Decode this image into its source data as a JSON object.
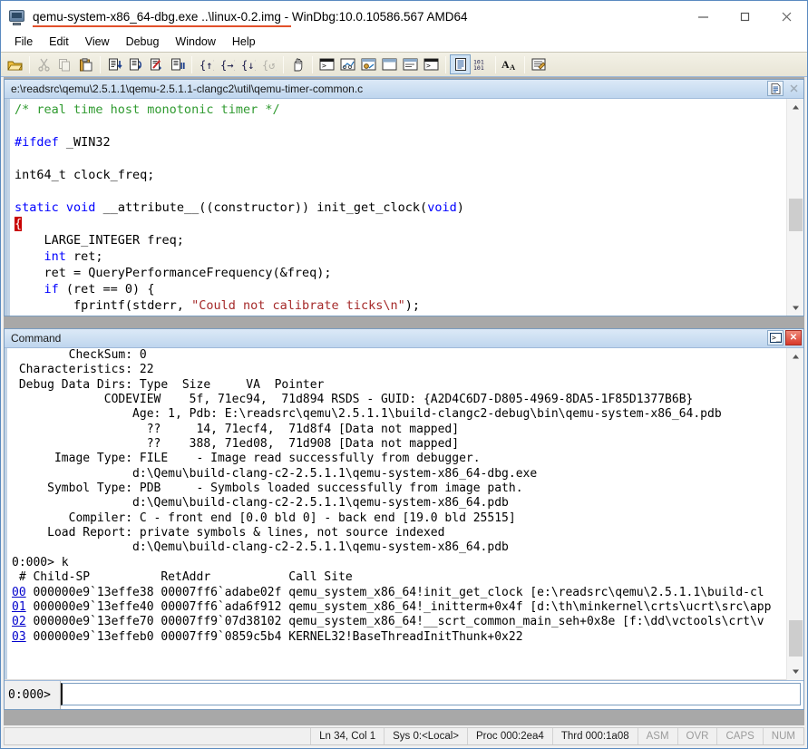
{
  "window": {
    "title": "qemu-system-x86_64-dbg.exe ..\\linux-0.2.img - WinDbg:10.0.10586.567 AMD64",
    "app_icon": "windbg-icon",
    "accent_underline_color": "#e2502a",
    "controls": {
      "minimize": "minimize-icon",
      "maximize": "maximize-icon",
      "close": "close-icon"
    }
  },
  "menubar": {
    "items": [
      {
        "label": "File"
      },
      {
        "label": "Edit"
      },
      {
        "label": "View"
      },
      {
        "label": "Debug"
      },
      {
        "label": "Window"
      },
      {
        "label": "Help"
      }
    ]
  },
  "toolbar": {
    "groups": [
      {
        "buttons": [
          {
            "name": "open-folder-icon",
            "enabled": true
          }
        ]
      },
      {
        "buttons": [
          {
            "name": "cut-icon",
            "enabled": false
          },
          {
            "name": "copy-icon",
            "enabled": false
          },
          {
            "name": "paste-icon",
            "enabled": true
          }
        ]
      },
      {
        "buttons": [
          {
            "name": "step-into-source-icon",
            "enabled": true
          },
          {
            "name": "step-over-source-icon",
            "enabled": true
          },
          {
            "name": "run-to-cursor-icon",
            "enabled": true
          },
          {
            "name": "break-icon",
            "enabled": true
          }
        ]
      },
      {
        "buttons": [
          {
            "name": "step-into-icon",
            "enabled": true
          },
          {
            "name": "step-over-icon",
            "enabled": true
          },
          {
            "name": "step-out-icon",
            "enabled": true
          },
          {
            "name": "restart-icon",
            "enabled": false
          }
        ]
      },
      {
        "buttons": [
          {
            "name": "stop-debugging-hand-icon",
            "enabled": true
          }
        ]
      },
      {
        "buttons": [
          {
            "name": "command-window-icon",
            "enabled": true
          },
          {
            "name": "watch-window-icon",
            "enabled": true
          },
          {
            "name": "locals-window-icon",
            "enabled": true
          },
          {
            "name": "registers-window-icon",
            "enabled": true
          },
          {
            "name": "memory-window-icon",
            "enabled": true
          },
          {
            "name": "callstack-window-icon",
            "enabled": true
          },
          {
            "name": "disassembly-window-icon",
            "enabled": true
          },
          {
            "name": "scratch-pad-icon",
            "enabled": true
          },
          {
            "name": "processes-threads-icon",
            "enabled": true
          },
          {
            "name": "command-browser-icon",
            "enabled": true
          }
        ]
      },
      {
        "buttons": [
          {
            "name": "source-window-icon",
            "enabled": true,
            "selected": true
          },
          {
            "name": "numbers-base-icon",
            "enabled": true
          }
        ]
      },
      {
        "buttons": [
          {
            "name": "font-icon",
            "enabled": true
          }
        ]
      },
      {
        "buttons": [
          {
            "name": "notes-icon",
            "enabled": true
          }
        ]
      }
    ]
  },
  "source_window": {
    "title": "e:\\readsrc\\qemu\\2.5.1.1\\qemu-2.5.1.1-clangc2\\util\\qemu-timer-common.c",
    "buttons": {
      "restore": "restore-document-icon",
      "close": "close-icon"
    },
    "lines": [
      {
        "segments": [
          {
            "t": "/* real time host monotonic timer */",
            "c": "cmt"
          }
        ]
      },
      {
        "segments": [
          {
            "t": "",
            "c": ""
          }
        ]
      },
      {
        "segments": [
          {
            "t": "#ifdef",
            "c": "pp"
          },
          {
            "t": " _WIN32",
            "c": ""
          }
        ]
      },
      {
        "segments": [
          {
            "t": "",
            "c": ""
          }
        ]
      },
      {
        "segments": [
          {
            "t": "int64_t clock_freq;",
            "c": ""
          }
        ]
      },
      {
        "segments": [
          {
            "t": "",
            "c": ""
          }
        ]
      },
      {
        "segments": [
          {
            "t": "static",
            "c": "kw"
          },
          {
            "t": " ",
            "c": ""
          },
          {
            "t": "void",
            "c": "kw"
          },
          {
            "t": " __attribute__((constructor)) init_get_clock(",
            "c": ""
          },
          {
            "t": "void",
            "c": "kw"
          },
          {
            "t": ")",
            "c": ""
          }
        ]
      },
      {
        "segments": [
          {
            "t": "{",
            "c": "bphl"
          }
        ]
      },
      {
        "segments": [
          {
            "t": "    LARGE_INTEGER freq;",
            "c": ""
          }
        ]
      },
      {
        "segments": [
          {
            "t": "    ",
            "c": ""
          },
          {
            "t": "int",
            "c": "kw"
          },
          {
            "t": " ret;",
            "c": ""
          }
        ]
      },
      {
        "segments": [
          {
            "t": "    ret = QueryPerformanceFrequency(&freq);",
            "c": ""
          }
        ]
      },
      {
        "segments": [
          {
            "t": "    ",
            "c": ""
          },
          {
            "t": "if",
            "c": "kw"
          },
          {
            "t": " (ret == 0) {",
            "c": ""
          }
        ]
      },
      {
        "segments": [
          {
            "t": "        fprintf(stderr, ",
            "c": ""
          },
          {
            "t": "\"Could not calibrate ticks\\n\"",
            "c": "str"
          },
          {
            "t": ");",
            "c": ""
          }
        ]
      }
    ],
    "scrollbar": {
      "up": "scroll-up-icon",
      "down": "scroll-down-icon",
      "thumb_top_pct": 46,
      "thumb_height_pct": 18
    }
  },
  "command_window": {
    "title": "Command",
    "buttons": {
      "dock": "command-window-icon",
      "close": "close-icon"
    },
    "output_lines": [
      {
        "segments": [
          {
            "t": "        CheckSum: 0"
          }
        ]
      },
      {
        "segments": [
          {
            "t": " Characteristics: 22"
          }
        ]
      },
      {
        "segments": [
          {
            "t": " Debug Data Dirs: Type  Size     VA  Pointer"
          }
        ]
      },
      {
        "segments": [
          {
            "t": "             CODEVIEW    5f, 71ec94,  71d894 RSDS - GUID: {A2D4C6D7-D805-4969-8DA5-1F85D1377B6B}"
          }
        ]
      },
      {
        "segments": [
          {
            "t": "                 Age: 1, Pdb: E:\\readsrc\\qemu\\2.5.1.1\\build-clangc2-debug\\bin\\qemu-system-x86_64.pdb"
          }
        ]
      },
      {
        "segments": [
          {
            "t": "                   ??     14, 71ecf4,  71d8f4 [Data not mapped]"
          }
        ]
      },
      {
        "segments": [
          {
            "t": "                   ??    388, 71ed08,  71d908 [Data not mapped]"
          }
        ]
      },
      {
        "segments": [
          {
            "t": "      Image Type: FILE    - Image read successfully from debugger."
          }
        ]
      },
      {
        "segments": [
          {
            "t": "                 d:\\Qemu\\build-clang-c2-2.5.1.1\\qemu-system-x86_64-dbg.exe"
          }
        ]
      },
      {
        "segments": [
          {
            "t": "     Symbol Type: PDB     - Symbols loaded successfully from image path."
          }
        ]
      },
      {
        "segments": [
          {
            "t": "                 d:\\Qemu\\build-clang-c2-2.5.1.1\\qemu-system-x86_64.pdb"
          }
        ]
      },
      {
        "segments": [
          {
            "t": "        Compiler: C - front end [0.0 bld 0] - back end [19.0 bld 25515]"
          }
        ]
      },
      {
        "segments": [
          {
            "t": "     Load Report: private symbols & lines, not source indexed"
          }
        ]
      },
      {
        "segments": [
          {
            "t": "                 d:\\Qemu\\build-clang-c2-2.5.1.1\\qemu-system-x86_64.pdb"
          }
        ]
      },
      {
        "segments": [
          {
            "t": "0:000> k"
          }
        ]
      },
      {
        "segments": [
          {
            "t": " # Child-SP          RetAddr           Call Site"
          }
        ]
      },
      {
        "segments": [
          {
            "t": "00",
            "c": "lnk"
          },
          {
            "t": " 000000e9`13effe38 00007ff6`adabe02f qemu_system_x86_64!init_get_clock [e:\\readsrc\\qemu\\2.5.1.1\\build-cl"
          }
        ]
      },
      {
        "segments": [
          {
            "t": "01",
            "c": "lnk"
          },
          {
            "t": " 000000e9`13effe40 00007ff6`ada6f912 qemu_system_x86_64!_initterm+0x4f [d:\\th\\minkernel\\crts\\ucrt\\src\\app"
          }
        ]
      },
      {
        "segments": [
          {
            "t": "02",
            "c": "lnk"
          },
          {
            "t": " 000000e9`13effe70 00007ff9`07d38102 qemu_system_x86_64!__scrt_common_main_seh+0x8e [f:\\dd\\vctools\\crt\\v"
          }
        ]
      },
      {
        "segments": [
          {
            "t": "03",
            "c": "lnk"
          },
          {
            "t": " 000000e9`13effeb0 00007ff9`0859c5b4 KERNEL32!BaseThreadInitThunk+0x22"
          }
        ]
      }
    ],
    "hscroll": {
      "left": "scroll-left-icon",
      "right": "scroll-right-icon",
      "thumb_width_pct": 86
    },
    "vscroll": {
      "up": "scroll-up-icon",
      "down": "scroll-down-icon"
    },
    "prompt": "0:000>",
    "input_value": "",
    "input_placeholder": ""
  },
  "statusbar": {
    "cells": [
      {
        "label": "Ln 34, Col 1",
        "dim": false
      },
      {
        "label": "Sys 0:<Local>",
        "dim": false
      },
      {
        "label": "Proc 000:2ea4",
        "dim": false
      },
      {
        "label": "Thrd 000:1a08",
        "dim": false
      },
      {
        "label": "ASM",
        "dim": true
      },
      {
        "label": "OVR",
        "dim": true
      },
      {
        "label": "CAPS",
        "dim": true
      },
      {
        "label": "NUM",
        "dim": true
      }
    ]
  }
}
